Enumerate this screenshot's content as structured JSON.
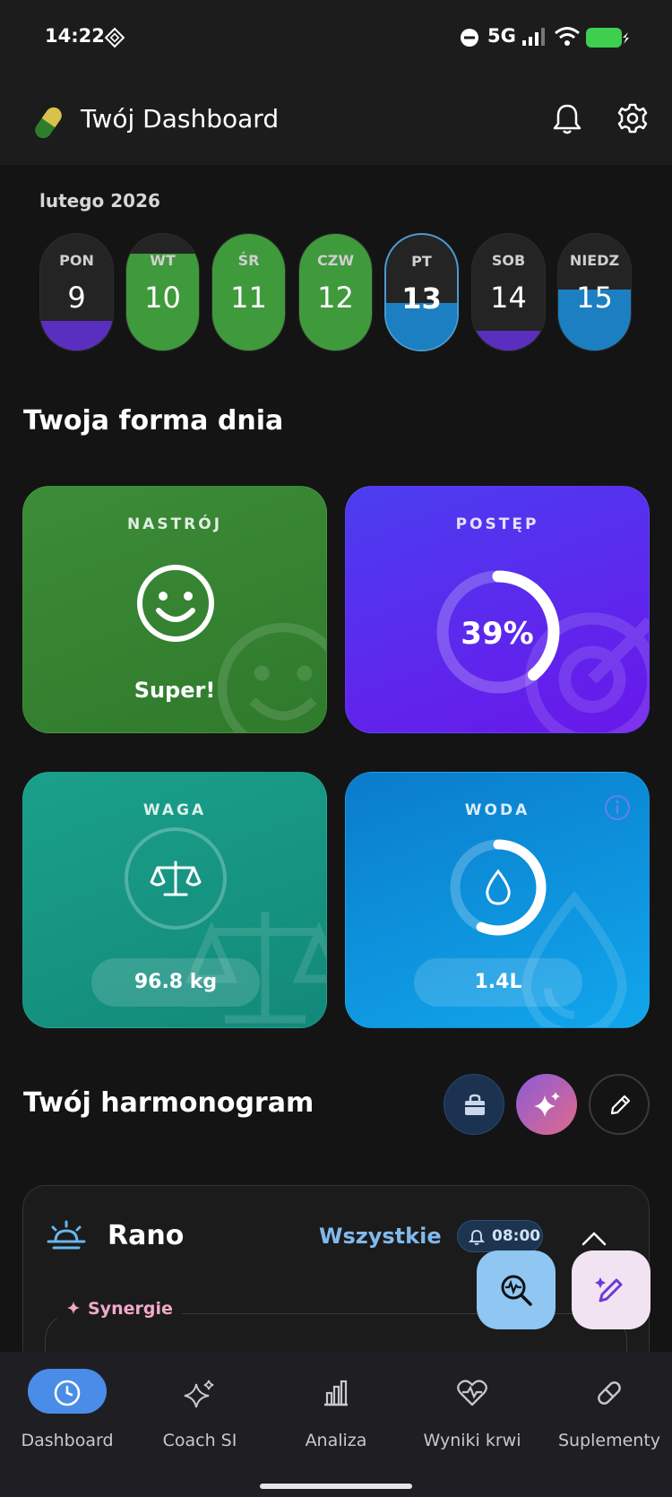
{
  "status_bar": {
    "time": "14:22",
    "network": "5G"
  },
  "header": {
    "title": "Twój Dashboard"
  },
  "calendar": {
    "month": "lutego 2026",
    "days": [
      {
        "name": "PON",
        "num": "9"
      },
      {
        "name": "WT",
        "num": "10"
      },
      {
        "name": "ŚR",
        "num": "11"
      },
      {
        "name": "CZW",
        "num": "12"
      },
      {
        "name": "PT",
        "num": "13"
      },
      {
        "name": "SOB",
        "num": "14"
      },
      {
        "name": "NIEDZ",
        "num": "15"
      }
    ]
  },
  "form_section": {
    "title": "Twoja forma dnia"
  },
  "cards": {
    "mood": {
      "label": "NASTRÓJ",
      "value": "Super!"
    },
    "progress": {
      "label": "POSTĘP",
      "value": "39%",
      "fraction": 0.39
    },
    "weight": {
      "label": "WAGA",
      "value": "96.8 kg"
    },
    "water": {
      "label": "WODA",
      "value": "1.4L"
    }
  },
  "schedule": {
    "title": "Twój harmonogram",
    "period": "Rano",
    "filter": "Wszystkie",
    "time": "08:00",
    "synergy_label": "Synergie"
  },
  "nav": {
    "items": [
      {
        "label": "Dashboard"
      },
      {
        "label": "Coach SI"
      },
      {
        "label": "Analiza"
      },
      {
        "label": "Wyniki krwi"
      },
      {
        "label": "Suplementy"
      }
    ]
  },
  "colors": {
    "green": "#3a8a36",
    "purple": "#5a2fd4",
    "blue": "#1a86c9",
    "teal": "#129a88",
    "accent": "#4a8de8"
  }
}
